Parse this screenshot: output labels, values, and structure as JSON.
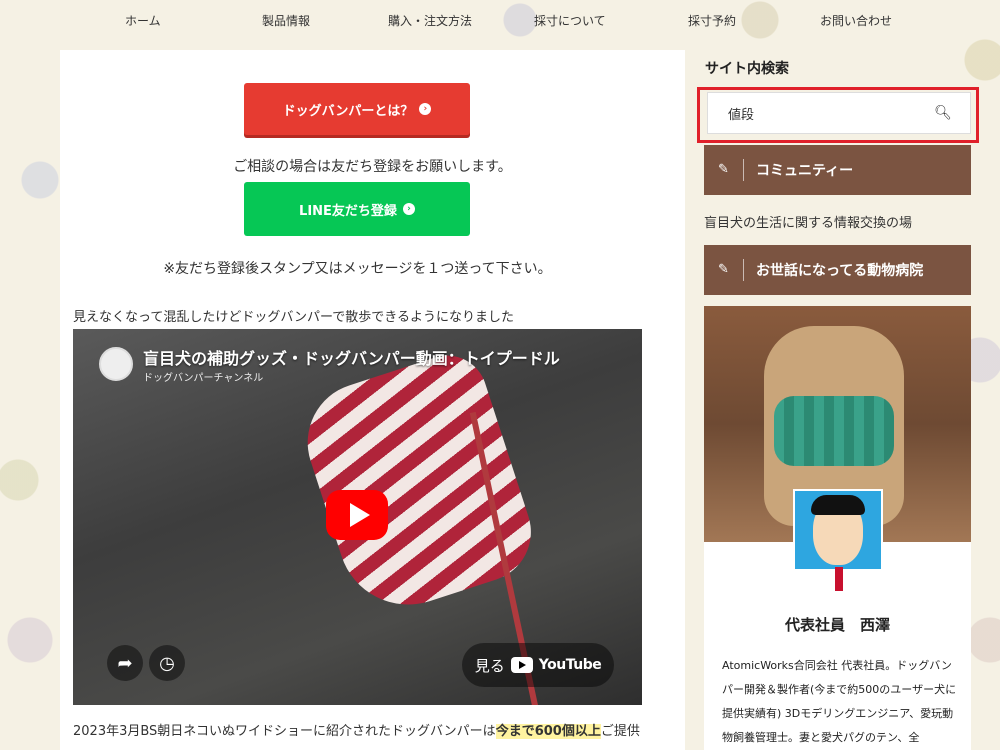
{
  "nav": {
    "items": [
      "ホーム",
      "製品情報",
      "購入・注文方法",
      "採寸について",
      "採寸予約",
      "お問い合わせ"
    ]
  },
  "main": {
    "about_button": "ドッグバンパーとは？",
    "consult_text": "ご相談の場合は友だち登録をお願いします。",
    "line_button": "LINE友だち登録",
    "stamp_text": "※友だち登録後スタンプ又はメッセージを１つ送って下さい。",
    "video_caption": "見えなくなって混乱したけどドッグバンパーで散歩できるようになりました",
    "video": {
      "title": "盲目犬の補助グッズ・ドッグバンパー動画：トイプードル",
      "channel": "ドッグバンパーチャンネル",
      "watch_on": "見る",
      "youtube": "YouTube"
    },
    "bottom_text_prefix": "2023年3月BS朝日ネコいぬワイドショーに紹介されたドッグバンパーは",
    "bottom_text_bold": "今まで600個以上",
    "bottom_text_suffix": "ご提供"
  },
  "sidebar": {
    "search_title": "サイト内検索",
    "search_value": "値段",
    "community_label": "コミュニティー",
    "community_text": "盲目犬の生活に関する情報交換の場",
    "hospital_label": "お世話になってる動物病院",
    "profile_name": "代表社員　西澤",
    "profile_bio": "AtomicWorks合同会社 代表社員。ドッグバンパー開発＆製作者(今まで約500のユーザー犬に提供実績有) 3Dモデリングエンジニア、愛玩動物飼養管理士。妻と愛犬パグのテン、全"
  },
  "colors": {
    "red_button": "#e63b31",
    "line_green": "#06c755",
    "brown_bar": "#7b5441",
    "highlight_box": "#e0202a",
    "youtube_red": "#ff0000"
  }
}
